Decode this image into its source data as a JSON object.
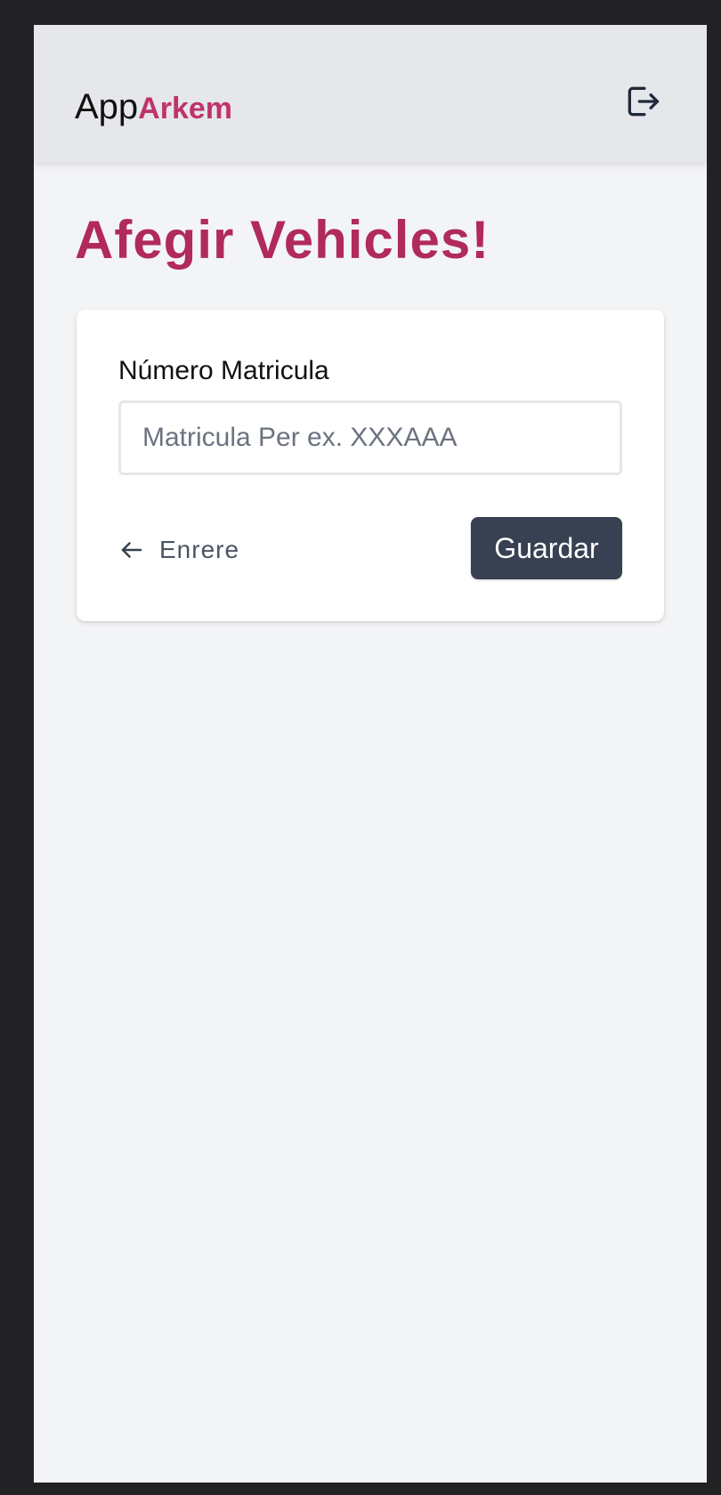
{
  "header": {
    "brand_prefix": "App",
    "brand_name": "Arkem",
    "logout_icon": "logout-icon"
  },
  "page": {
    "title": "Afegir Vehicles!"
  },
  "form": {
    "plate_label": "Número Matricula",
    "plate_value": "",
    "plate_placeholder": "Matricula Per ex. XXXAAA",
    "back_icon": "arrow-left-icon",
    "back_label": "Enrere",
    "save_label": "Guardar"
  },
  "colors": {
    "accent": "#c0336a",
    "title": "#b02a5e",
    "header_bg": "#e5e7eb",
    "page_bg": "#f3f4f6",
    "button_bg": "#374151"
  }
}
